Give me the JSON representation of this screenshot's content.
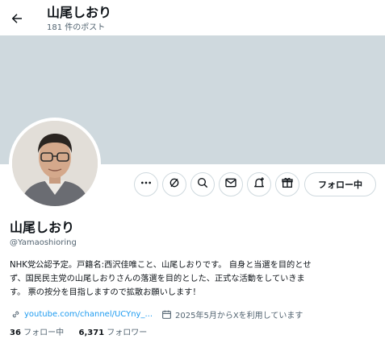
{
  "header": {
    "title": "山尾しおり",
    "post_count": "181 件のポスト"
  },
  "profile": {
    "name": "山尾しおり",
    "handle": "@Yamaoshioring",
    "bio_lines": [
      "NHK党公認予定。戸籍名:西沢佳唯こと、山尾しおりです。 自身と当選を目的とせ",
      "ず、国民民主党の山尾しおりさんの落選を目的とした、正式な活動をしていきま",
      "す。 票の按分を目指しますので拡散お願いします！"
    ],
    "link": "youtube.com/channel/UCYny_...",
    "joined": "2025年5月からXを利用しています",
    "following_count": "36",
    "following_label": " フォロー中",
    "followers_count": "6,371",
    "followers_label": " フォロワー"
  },
  "actions": {
    "follow_label": "フォロー中",
    "icons": [
      "more-icon",
      "grok-icon",
      "search-icon",
      "message-icon",
      "notify-icon",
      "gift-icon"
    ]
  },
  "colors": {
    "banner": "#cfd9de",
    "link": "#1d9bf0",
    "secondary_text": "#536471"
  }
}
